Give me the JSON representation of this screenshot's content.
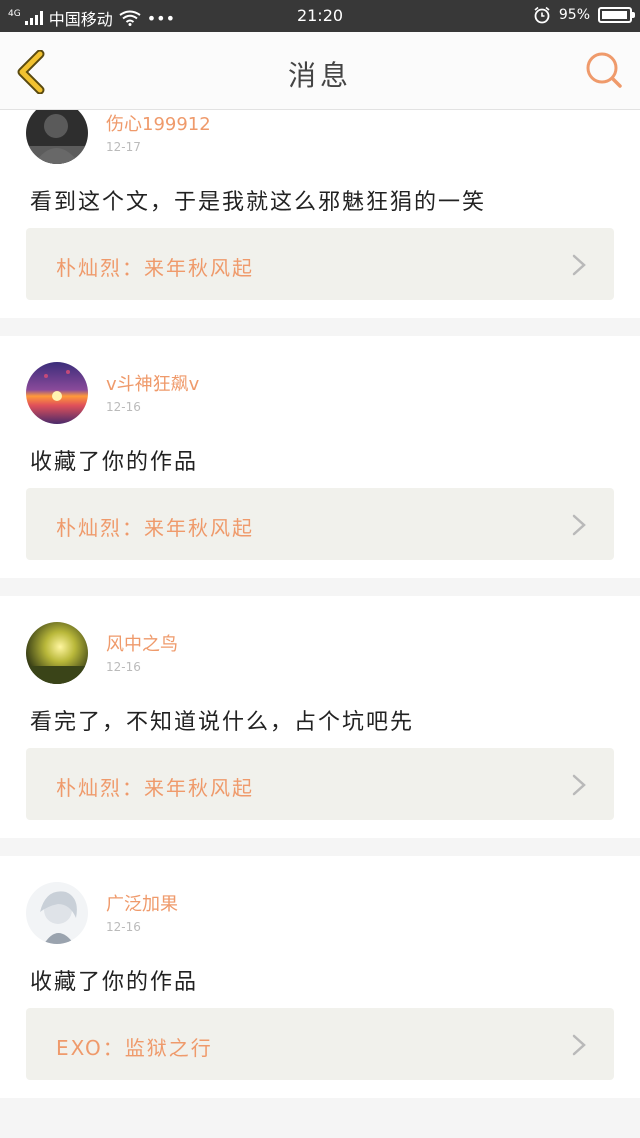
{
  "status_bar": {
    "network": "4G",
    "carrier": "中国移动",
    "dots": "•••",
    "time": "21:20",
    "battery": "95%"
  },
  "header": {
    "title": "消息",
    "back_icon": "chevron-left-icon",
    "search_icon": "search-icon"
  },
  "messages": [
    {
      "username": "伤心199912",
      "date": "12-17",
      "text": "看到这个文，于是我就这么邪魅狂狷的一笑",
      "ref": "朴灿烈：来年秋风起"
    },
    {
      "username": "v斗神狂飙v",
      "date": "12-16",
      "text": "收藏了你的作品",
      "ref": "朴灿烈：来年秋风起"
    },
    {
      "username": "风中之鸟",
      "date": "12-16",
      "text": "看完了，不知道说什么，占个坑吧先",
      "ref": "朴灿烈：来年秋风起"
    },
    {
      "username": "广泛加果",
      "date": "12-16",
      "text": "收藏了你的作品",
      "ref": "EXO：监狱之行"
    }
  ],
  "colors": {
    "accent": "#ef9a6b",
    "back_icon": "#f2c230",
    "status_bar": "#383838",
    "ref_bg": "#f1f1ec"
  }
}
